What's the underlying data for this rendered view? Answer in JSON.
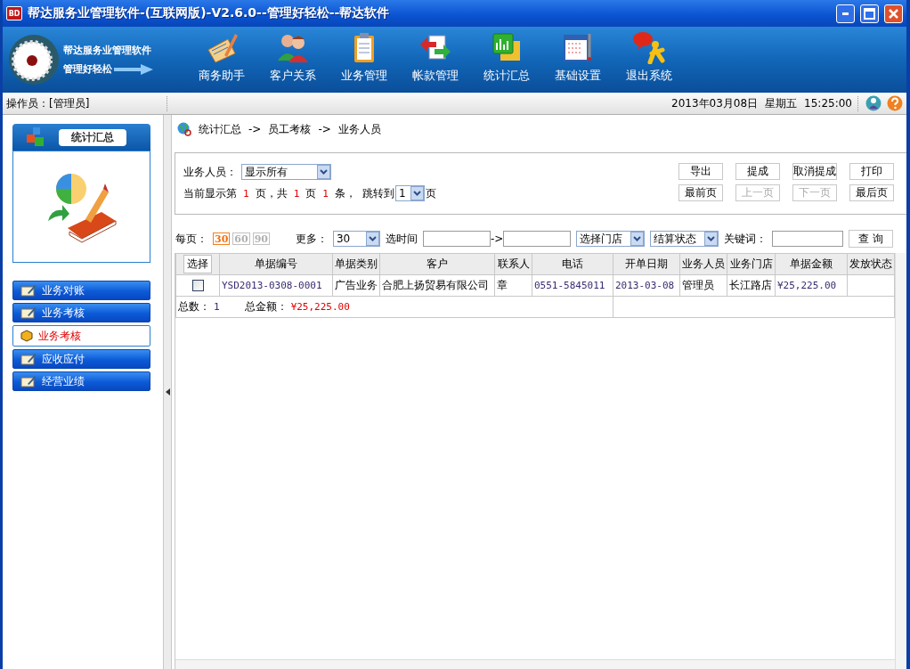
{
  "window": {
    "icon_text": "BD",
    "title": "帮达服务业管理软件-(互联网版)-V2.6.0--管理好轻松--帮达软件"
  },
  "logo": {
    "name": "帮达服务业管理软件",
    "slogan": "管理好轻松"
  },
  "toolbar": [
    {
      "label": "商务助手"
    },
    {
      "label": "客户关系"
    },
    {
      "label": "业务管理"
    },
    {
      "label": "帐款管理"
    },
    {
      "label": "统计汇总"
    },
    {
      "label": "基础设置"
    },
    {
      "label": "退出系统"
    }
  ],
  "status_bar": {
    "operator_label": "操作员：",
    "operator": "[管理员]",
    "date": "2013年03月08日",
    "weekday": "星期五",
    "time": "15:25:00"
  },
  "sidebar": {
    "title": "统计汇总",
    "items": [
      {
        "label": "业务对账",
        "selected": false
      },
      {
        "label": "业务考核",
        "selected": false
      },
      {
        "label": "业务考核",
        "selected": true
      },
      {
        "label": "应收应付",
        "selected": false
      },
      {
        "label": "经营业绩",
        "selected": false
      }
    ]
  },
  "breadcrumb": [
    "统计汇总",
    "->",
    "员工考核",
    "->",
    "业务人员"
  ],
  "filter": {
    "salesperson_label": "业务人员：",
    "salesperson": "显示所有",
    "page_info": [
      {
        "kind": "label",
        "text": "当前显示第"
      },
      {
        "kind": "number",
        "text": "1"
      },
      {
        "kind": "label",
        "text": "页，共"
      },
      {
        "kind": "number",
        "text": "1"
      },
      {
        "kind": "label",
        "text": "页"
      },
      {
        "kind": "number",
        "text": "1"
      },
      {
        "kind": "label",
        "text": "条，"
      },
      {
        "kind": "label",
        "text": "跳转到"
      }
    ],
    "jump_page": "1",
    "jump_suffix": "页"
  },
  "actions": [
    {
      "label": "导出",
      "disabled": false
    },
    {
      "label": "提成",
      "disabled": false
    },
    {
      "label": "取消提成",
      "disabled": false
    },
    {
      "label": "打印",
      "disabled": false
    },
    {
      "label": "最前页",
      "disabled": false
    },
    {
      "label": "上一页",
      "disabled": true
    },
    {
      "label": "下一页",
      "disabled": true
    },
    {
      "label": "最后页",
      "disabled": false
    }
  ],
  "query": {
    "per_page_label": "每页：",
    "per_page": [
      {
        "label": "30",
        "selected": true
      },
      {
        "label": "60",
        "selected": false
      },
      {
        "label": "90",
        "selected": false
      }
    ],
    "more_label": "更多：",
    "more_value": "30",
    "time_label": "选时间",
    "range_sep": "->",
    "store": "选择门店",
    "settle": "结算状态",
    "keyword_label": "关键词：",
    "search_button": "查 询"
  },
  "table": {
    "columns": [
      {
        "kind": "check",
        "label": "选择"
      },
      {
        "kind": "code",
        "label": "单据编号"
      },
      {
        "kind": "text",
        "label": "单据类别"
      },
      {
        "kind": "text",
        "label": "客户"
      },
      {
        "kind": "text",
        "label": "联系人"
      },
      {
        "kind": "code",
        "label": "电话"
      },
      {
        "kind": "code",
        "label": "开单日期"
      },
      {
        "kind": "text",
        "label": "业务人员"
      },
      {
        "kind": "text",
        "label": "业务门店"
      },
      {
        "kind": "code",
        "label": "单据金额"
      },
      {
        "kind": "text",
        "label": "发放状态"
      }
    ],
    "rows": [
      {
        "checked": false,
        "cells": [
          "",
          "YSD2013-0308-0001",
          "广告业务",
          "合肥上扬贸易有限公司",
          "章",
          "0551-5845011",
          "2013-03-08",
          "管理员",
          "长江路店",
          "¥25,225.00",
          ""
        ]
      }
    ],
    "footer": {
      "count_label": "总数：",
      "count": "1",
      "total_label": "总金额：",
      "total": "¥25,225.00"
    }
  }
}
